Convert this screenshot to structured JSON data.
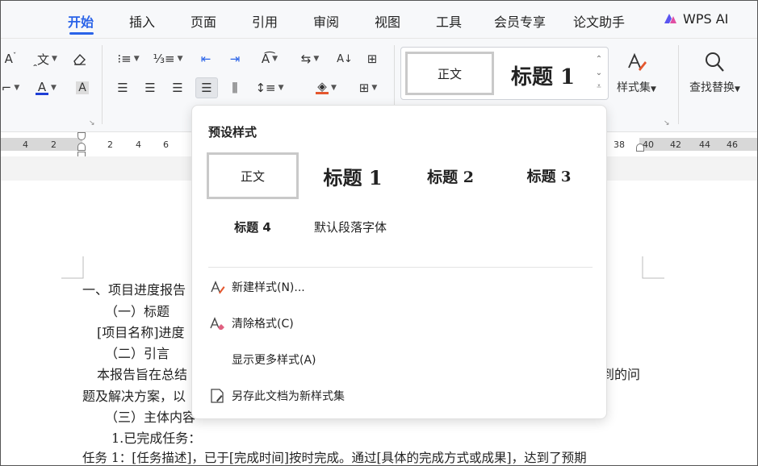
{
  "menubar": {
    "tabs": [
      {
        "label": "开始",
        "active": true
      },
      {
        "label": "插入"
      },
      {
        "label": "页面"
      },
      {
        "label": "引用"
      },
      {
        "label": "审阅"
      },
      {
        "label": "视图"
      },
      {
        "label": "工具"
      },
      {
        "label": "会员专享"
      },
      {
        "label": "论文助手"
      }
    ],
    "ai_label": "WPS AI",
    "accent_color": "#2a63e8"
  },
  "ribbon": {
    "style_gallery": {
      "normal": "正文",
      "heading1": "标题 1"
    },
    "styleset_label": "样式集",
    "find_replace_label": "查找替换",
    "font_color": "#1f3fd6",
    "highlight_color": "#e4572e"
  },
  "ruler": {
    "left_ticks": [
      "4",
      "2"
    ],
    "right_of_margin_ticks": [
      "2",
      "4",
      "6"
    ],
    "far_ticks": [
      "38",
      "40",
      "42",
      "44",
      "46"
    ]
  },
  "document": {
    "lines": [
      "一、项目进度报告",
      "（一）标题",
      "[项目名称]进度",
      "（二）引言",
      "本报告旨在总结",
      "到的问",
      "题及解决方案，以",
      "（三）主体内容",
      "1.已完成任务：",
      "任务 1：[任务描述]，已于[完成时间]按时完成。通过[具体的完成方式或成果]，达到了预期"
    ]
  },
  "style_popup": {
    "title": "预设样式",
    "presets": {
      "normal": "正文",
      "h1": "标题  1",
      "h2": "标题  2",
      "h3": "标题  3",
      "h4": "标题  4",
      "default_font": "默认段落字体"
    },
    "actions": {
      "new_style": "新建样式(N)...",
      "clear_format": "清除格式(C)",
      "more_styles": "显示更多样式(A)",
      "save_set": "另存此文档为新样式集"
    }
  }
}
